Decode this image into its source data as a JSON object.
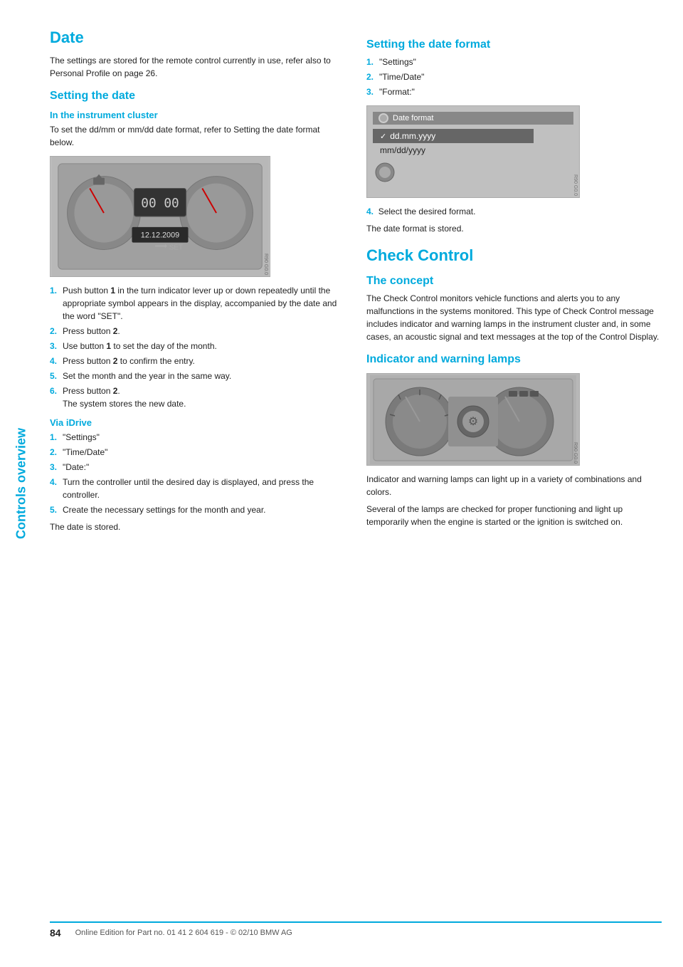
{
  "sidebar": {
    "label": "Controls overview"
  },
  "left_col": {
    "section_title": "Date",
    "intro_text": "The settings are stored for the remote control currently in use, refer also to Personal Profile on page 26.",
    "setting_the_date": {
      "heading": "Setting the date",
      "subheading": "In the instrument cluster",
      "body": "To set the dd/mm or mm/dd date format, refer to Setting the date format below.",
      "cluster_image_label": "Instrument cluster showing 12.12.2009 SET",
      "steps": [
        {
          "num": "1.",
          "text": "Push button ",
          "bold": "1",
          "rest": " in the turn indicator lever up or down repeatedly until the appropriate symbol appears in the display, accompanied by the date and the word \"SET\"."
        },
        {
          "num": "2.",
          "text": "Press button ",
          "bold": "2",
          "rest": "."
        },
        {
          "num": "3.",
          "text": "Use button ",
          "bold": "1",
          "rest": " to set the day of the month."
        },
        {
          "num": "4.",
          "text": "Press button ",
          "bold": "2",
          "rest": " to confirm the entry."
        },
        {
          "num": "5.",
          "text": "Set the month and the year in the same way."
        },
        {
          "num": "6.",
          "text": "Press button ",
          "bold": "2",
          "rest": ".\nThe system stores the new date."
        }
      ],
      "via_idrive_heading": "Via iDrive",
      "via_idrive_steps": [
        {
          "num": "1.",
          "text": "\"Settings\""
        },
        {
          "num": "2.",
          "text": "\"Time/Date\""
        },
        {
          "num": "3.",
          "text": "\"Date:\""
        },
        {
          "num": "4.",
          "text": "Turn the controller until the desired day is displayed, and press the controller."
        },
        {
          "num": "5.",
          "text": "Create the necessary settings for the month and year."
        }
      ],
      "date_stored_text": "The date is stored."
    }
  },
  "right_col": {
    "setting_date_format": {
      "heading": "Setting the date format",
      "steps": [
        {
          "num": "1.",
          "text": "\"Settings\""
        },
        {
          "num": "2.",
          "text": "\"Time/Date\""
        },
        {
          "num": "3.",
          "text": "\"Format:\""
        }
      ],
      "step4": "4.",
      "step4_text": "Select the desired format.",
      "stored_text": "The date format is stored.",
      "format_option_1": "dd.mm.yyyy",
      "format_option_2": "mm/dd/yyyy",
      "format_header": "Date format"
    },
    "check_control": {
      "heading": "Check Control",
      "concept_heading": "The concept",
      "concept_text": "The Check Control monitors vehicle functions and alerts you to any malfunctions in the systems monitored. This type of Check Control message includes indicator and warning lamps in the instrument cluster and, in some cases, an acoustic signal and text messages at the top of the Control Display.",
      "indicator_heading": "Indicator and warning lamps",
      "indicator_text1": "Indicator and warning lamps can light up in a variety of combinations and colors.",
      "indicator_text2": "Several of the lamps are checked for proper functioning and light up temporarily when the engine is started or the ignition is switched on."
    }
  },
  "footer": {
    "page_number": "84",
    "footer_text": "Online Edition for Part no. 01 41 2 604 619 - © 02/10 BMW AG"
  }
}
